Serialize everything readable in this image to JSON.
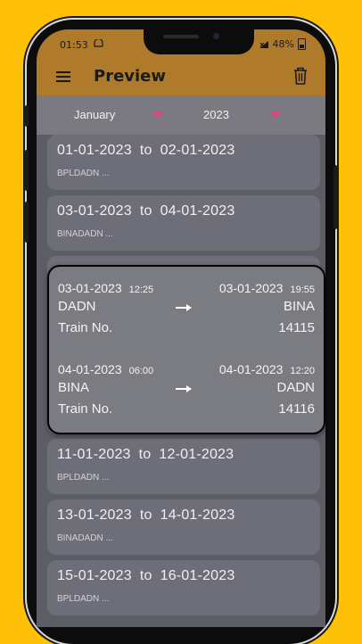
{
  "status": {
    "time": "01:53",
    "sim_icon": "sim-icon",
    "battery": "48%"
  },
  "appbar": {
    "title": "Preview",
    "menu_icon": "menu-icon",
    "delete_icon": "trash-icon"
  },
  "filters": {
    "month": "January",
    "year": "2023"
  },
  "list": {
    "separator": "to",
    "items": [
      {
        "from": "01-01-2023",
        "to": "02-01-2023",
        "route": "BPLDADN ..."
      },
      {
        "from": "03-01-2023",
        "to": "04-01-2023",
        "route": "BINADADN ..."
      },
      {
        "from": "11-01-2023",
        "to": "12-01-2023",
        "route": "BPLDADN ..."
      },
      {
        "from": "13-01-2023",
        "to": "14-01-2023",
        "route": "BINADADN ..."
      },
      {
        "from": "15-01-2023",
        "to": "16-01-2023",
        "route": "BPLDADN ..."
      }
    ]
  },
  "popup": {
    "train_label": "Train No.",
    "legs": [
      {
        "dep_date": "03-01-2023",
        "dep_time": "12:25",
        "arr_date": "03-01-2023",
        "arr_time": "19:55",
        "from": "DADN",
        "to": "BINA",
        "train_no": "14115"
      },
      {
        "dep_date": "04-01-2023",
        "dep_time": "06:00",
        "arr_date": "04-01-2023",
        "arr_time": "12:20",
        "from": "BINA",
        "to": "DADN",
        "train_no": "14116"
      }
    ]
  },
  "colors": {
    "background": "#FFC107",
    "appbar": "#B07A2B",
    "card": "#6e6e78",
    "dropdown_arrow": "#e4407a"
  }
}
